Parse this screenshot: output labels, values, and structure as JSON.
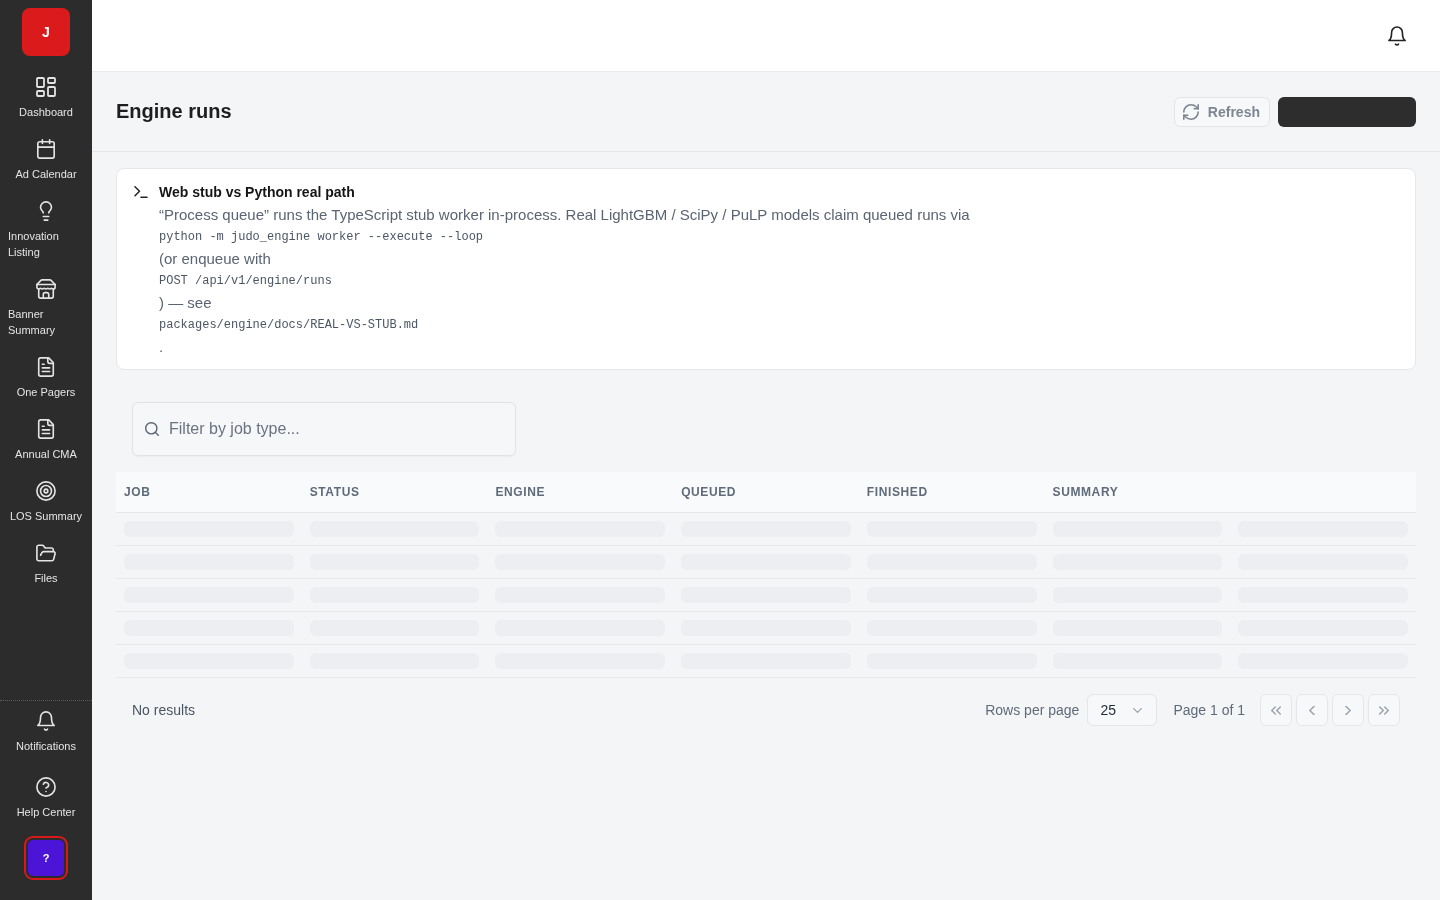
{
  "sidebar": {
    "logo": {
      "label": "J"
    },
    "items": [
      {
        "label": "Dashboard",
        "selected": false
      },
      {
        "label": "Ad Calendar",
        "selected": false
      },
      {
        "label": "Innovation Listing",
        "selected": false
      },
      {
        "label": "Banner Summary",
        "selected": false
      },
      {
        "label": "One Pagers",
        "selected": false
      },
      {
        "label": "Annual CMA",
        "selected": false
      },
      {
        "label": "LOS Summary",
        "selected": false
      },
      {
        "label": "Files",
        "selected": false
      }
    ],
    "bottom_items": [
      {
        "label": "Notifications",
        "selected": false
      },
      {
        "label": "Help Center",
        "selected": false
      }
    ],
    "help_button": {
      "label": "?",
      "focused": true
    }
  },
  "page_header": {
    "title": "Engine runs",
    "actions": [
      {
        "kind": "refresh",
        "label": "Refresh",
        "disabled": true
      },
      {
        "kind": "primary"
      }
    ]
  },
  "callout": {
    "title": "Web stub vs Python real path",
    "lines": [
      {
        "kind": "text",
        "text": "“Process queue” runs the TypeScript stub worker in-process. Real LightGBM / SciPy / PuLP models claim queued runs via"
      },
      {
        "kind": "code",
        "text": "python -m judo_engine worker --execute --loop"
      },
      {
        "kind": "text",
        "text": "(or enqueue with"
      },
      {
        "kind": "code",
        "text": "POST /api/v1/engine/runs"
      },
      {
        "kind": "text",
        "text": ") — see"
      },
      {
        "kind": "code",
        "text": "packages/engine/docs/REAL-VS-STUB.md"
      },
      {
        "kind": "text",
        "text": "."
      }
    ]
  },
  "filter": {
    "placeholder": "Filter by job type..."
  },
  "table": {
    "columns": [
      "JOB",
      "STATUS",
      "ENGINE",
      "QUEUED",
      "FINISHED",
      "SUMMARY"
    ],
    "loading": true
  },
  "footer": {
    "status": "No results",
    "rows_per_page_label": "Rows per page",
    "rows_per_page": "25",
    "page_label": "Page 1 of 1",
    "buttons": [
      {
        "kind": "first",
        "disabled": true
      },
      {
        "kind": "previous",
        "disabled": true
      },
      {
        "kind": "next",
        "disabled": true
      },
      {
        "kind": "last",
        "disabled": true
      }
    ]
  }
}
